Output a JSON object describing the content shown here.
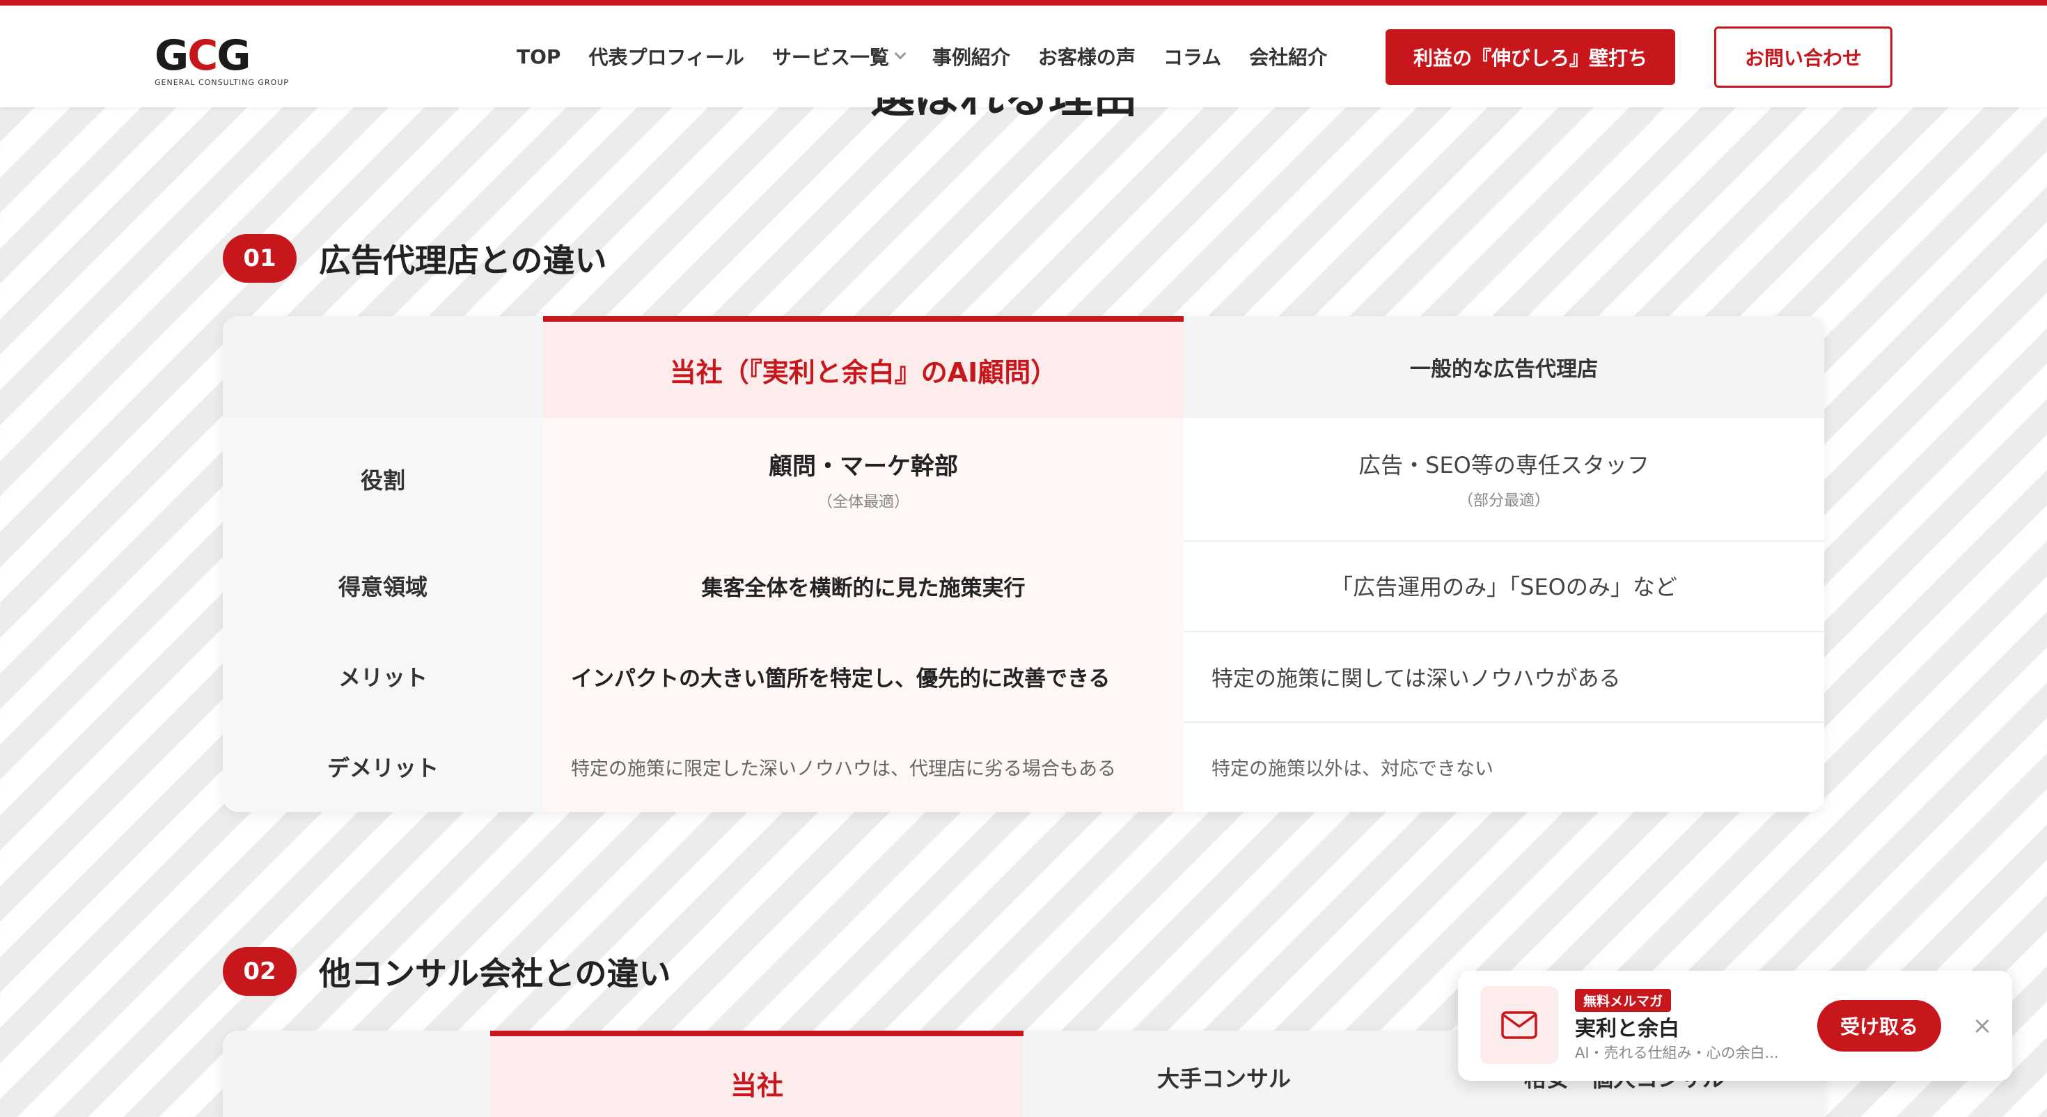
{
  "brand": {
    "logo_letters": [
      "G",
      "C",
      "G"
    ],
    "logo_sub": "GENERAL CONSULTING GROUP",
    "accent_color": "#c8161d"
  },
  "nav": {
    "items": [
      "TOP",
      "代表プロフィール",
      "サービス一覧",
      "事例紹介",
      "お客様の声",
      "コラム",
      "会社紹介"
    ],
    "cta_primary": "利益の『伸びしろ』壁打ち",
    "cta_secondary": "お問い合わせ"
  },
  "page": {
    "section_heading_partial": "選ばれる理由"
  },
  "section1": {
    "number": "01",
    "title": "広告代理店との違い",
    "col_ours": "当社（『実利と余白』のAI顧問）",
    "col_general": "一般的な広告代理店",
    "rows": [
      {
        "label": "役割",
        "ours": "顧問・マーケ幹部",
        "ours_sub": "（全体最適）",
        "general": "広告・SEO等の専任スタッフ",
        "general_sub": "（部分最適）"
      },
      {
        "label": "得意領域",
        "ours": "集客全体を横断的に見た施策実行",
        "ours_sub": "",
        "general": "「広告運用のみ」「SEOのみ」など",
        "general_sub": ""
      },
      {
        "label": "メリット",
        "ours": "インパクトの大きい箇所を特定し、優先的に改善できる",
        "ours_sub": "",
        "general": "特定の施策に関しては深いノウハウがある",
        "general_sub": ""
      },
      {
        "label": "デメリット",
        "ours": "特定の施策に限定した深いノウハウは、代理店に劣る場合もある",
        "ours_sub": "",
        "general": "特定の施策以外は、対応できない",
        "general_sub": ""
      }
    ]
  },
  "section2": {
    "number": "02",
    "title": "他コンサル会社との違い",
    "col_ours": "当社",
    "col_large": "大手コンサル",
    "col_small": "格安・個人コンサル"
  },
  "popup": {
    "tag": "無料メルマガ",
    "title": "実利と余白",
    "desc": "AI・売れる仕組み・心の余白...",
    "button": "受け取る",
    "close": "×",
    "icon": "mail-icon"
  }
}
